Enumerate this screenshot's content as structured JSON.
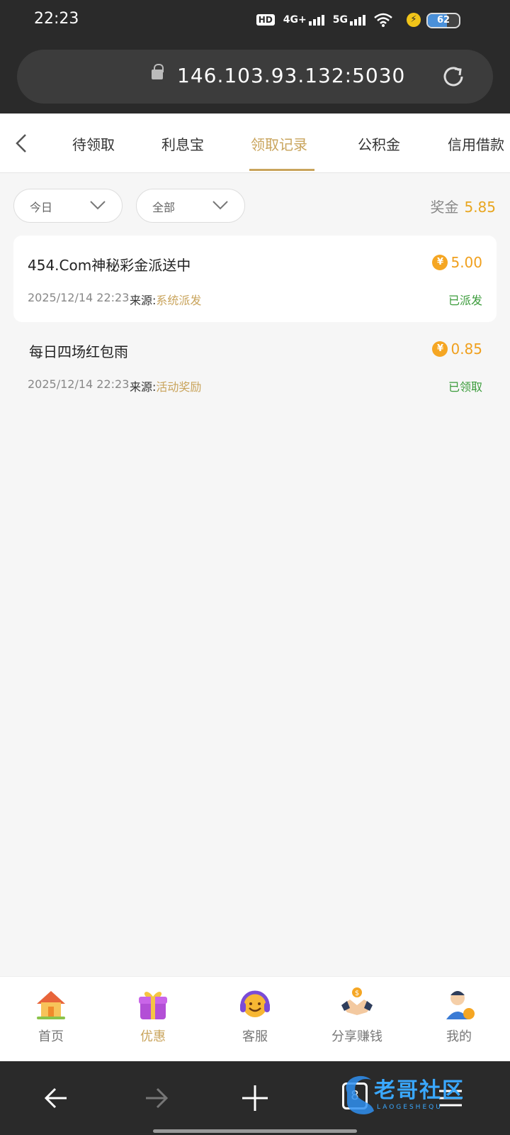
{
  "status_bar": {
    "time": "22:23",
    "hd": "HD",
    "network_1": "4G+",
    "network_2": "5G",
    "battery": "62",
    "battery_level": 0.62
  },
  "browser": {
    "url": "146.103.93.132:5030",
    "tab_count": "8"
  },
  "tabs": [
    {
      "label": "待领取"
    },
    {
      "label": "利息宝"
    },
    {
      "label": "领取记录",
      "active": true
    },
    {
      "label": "公积金"
    },
    {
      "label": "信用借款"
    }
  ],
  "filters": {
    "date": "今日",
    "type": "全部"
  },
  "bonus": {
    "label": "奖金",
    "value": "5.85"
  },
  "records": [
    {
      "title": "454.Com神秘彩金派送中",
      "amount": "5.00",
      "currency_symbol": "¥",
      "date": "2025/12/14 22:23",
      "source_label": "来源:",
      "source": "系统派发",
      "status": "已派发"
    },
    {
      "title": "每日四场红包雨",
      "amount": "0.85",
      "currency_symbol": "¥",
      "date": "2025/12/14 22:23",
      "source_label": "来源:",
      "source": "活动奖励",
      "status": "已领取"
    }
  ],
  "bottom_nav": [
    {
      "label": "首页",
      "icon": "home-icon"
    },
    {
      "label": "优惠",
      "icon": "gift-icon",
      "active": true
    },
    {
      "label": "客服",
      "icon": "headset-icon"
    },
    {
      "label": "分享赚钱",
      "icon": "handshake-icon"
    },
    {
      "label": "我的",
      "icon": "user-icon"
    }
  ],
  "watermark": {
    "text": "老哥社区",
    "sub": "LAOGESHEQU"
  },
  "colors": {
    "accent": "#c9a45c",
    "amount": "#f0a01e",
    "status_green": "#3a9b3a",
    "chrome": "#2a2a2a"
  }
}
